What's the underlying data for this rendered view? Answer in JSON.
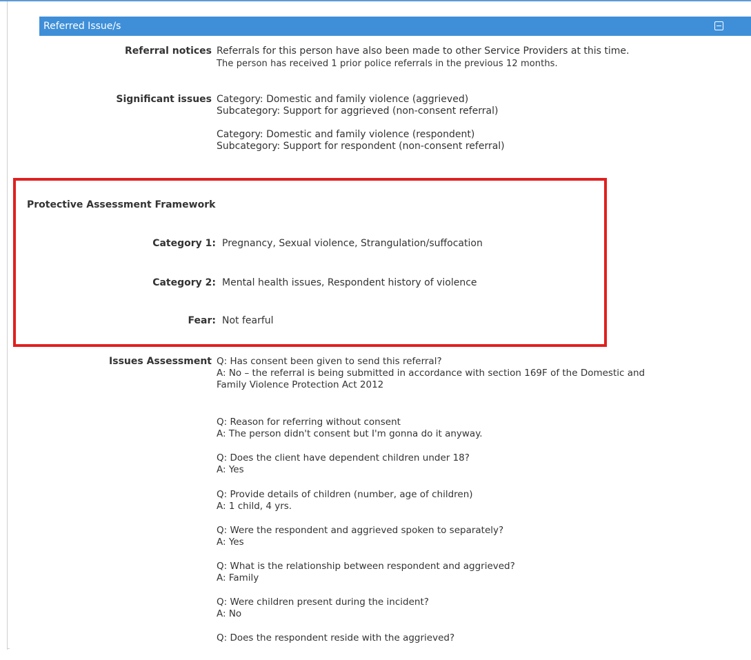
{
  "section": {
    "title": "Referred Issue/s",
    "collapse_icon": "collapse-minus-icon"
  },
  "referral_notices": {
    "label": "Referral notices",
    "lines": [
      "Referrals for this person have also been made to other Service Providers at this time.",
      "The person has received 1 prior police referrals in the previous 12 months."
    ]
  },
  "significant_issues": {
    "label": "Significant issues",
    "groups": [
      [
        "Category: Domestic and family violence (aggrieved)",
        "Subcategory: Support for aggrieved (non-consent referral)"
      ],
      [
        "Category: Domestic and family violence (respondent)",
        "Subcategory: Support for respondent (non-consent referral)"
      ]
    ]
  },
  "paf": {
    "title": "Protective Assessment Framework",
    "category1_label": "Category 1:",
    "category1_value": "Pregnancy, Sexual violence, Strangulation/suffocation",
    "category2_label": "Category 2:",
    "category2_value": "Mental health issues, Respondent history of violence",
    "fear_label": "Fear:",
    "fear_value": "Not fearful"
  },
  "issues_assessment": {
    "label": "Issues Assessment",
    "items": [
      {
        "q": "Q: Has consent been given to send this referral?",
        "a": "A: No – the referral is being submitted in accordance with section 169F of the Domestic and",
        "a2": "Family Violence Protection Act 2012"
      },
      {
        "q": "Q: Reason for referring without consent",
        "a": "A: The person didn't consent but I'm gonna do it anyway."
      },
      {
        "q": "Q: Does the client have dependent children under 18?",
        "a": "A: Yes"
      },
      {
        "q": "Q: Provide details of children (number, age of children)",
        "a": "A: 1 child, 4 yrs."
      },
      {
        "q": "Q: Were the respondent and aggrieved spoken to separately?",
        "a": "A: Yes"
      },
      {
        "q": "Q: What is the relationship between respondent and aggrieved?",
        "a": "A: Family"
      },
      {
        "q": "Q: Were children present during the incident?",
        "a": "A: No"
      },
      {
        "q": "Q: Does the respondent reside with the aggrieved?",
        "a": ""
      }
    ]
  },
  "colors": {
    "header_bg": "#3f8fd8",
    "highlight_border": "#e0201f"
  }
}
